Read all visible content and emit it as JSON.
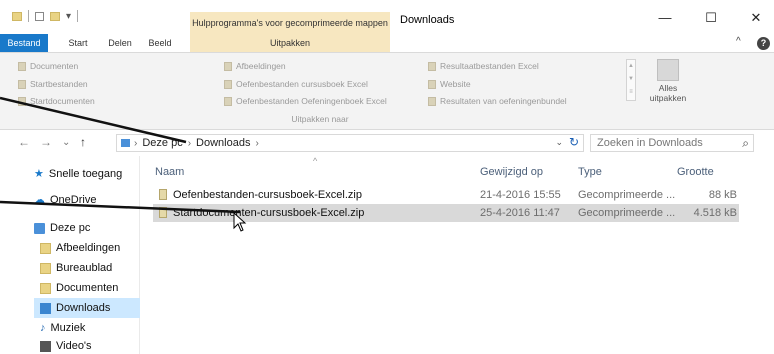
{
  "window": {
    "contextual_group_title": "Hulpprogramma's voor gecomprimeerde mappen",
    "title": "Downloads",
    "minimize": "—",
    "maximize": "☐",
    "close": "✕"
  },
  "ribbon_tabs": {
    "file": "Bestand",
    "home": "Start",
    "share": "Delen",
    "view": "Beeld",
    "extract": "Uitpakken",
    "collapse": "^",
    "help": "?"
  },
  "ribbon": {
    "destinations": [
      "Documenten",
      "Startbestanden",
      "Startdocumenten",
      "Afbeeldingen",
      "Oefenbestanden cursusboek Excel",
      "Oefenbestanden Oefeningenboek Excel",
      "Resultaatbestanden Excel",
      "Website",
      "Resultaten van oefeningenbundel"
    ],
    "group_label": "Uitpakken naar",
    "extract_all": "Alles uitpakken"
  },
  "address": {
    "back": "←",
    "forward": "→",
    "recent": "⌄",
    "up": "↑",
    "path": [
      "Deze pc",
      "Downloads"
    ],
    "dropdown": "⌄",
    "refresh": "↻",
    "search_placeholder": "Zoeken in Downloads",
    "search_icon": "⌕"
  },
  "nav_pane": {
    "items": [
      {
        "label": "Snelle toegang",
        "icon": "star-icon"
      },
      {
        "label": "OneDrive",
        "icon": "cloud-icon"
      },
      {
        "label": "Deze pc",
        "icon": "pc-icon"
      },
      {
        "label": "Afbeeldingen",
        "icon": "pictures-folder-icon"
      },
      {
        "label": "Bureaublad",
        "icon": "desktop-folder-icon"
      },
      {
        "label": "Documenten",
        "icon": "documents-folder-icon"
      },
      {
        "label": "Downloads",
        "icon": "downloads-folder-icon"
      },
      {
        "label": "Muziek",
        "icon": "music-icon"
      },
      {
        "label": "Video's",
        "icon": "video-icon"
      }
    ],
    "selected": "Downloads"
  },
  "file_list": {
    "columns": [
      "Naam",
      "Gewijzigd op",
      "Type",
      "Grootte"
    ],
    "sort_indicator": "^",
    "rows": [
      {
        "name": "Oefenbestanden-cursusboek-Excel.zip",
        "modified": "21-4-2016 15:55",
        "type": "Gecomprimeerde ...",
        "size": "88 kB"
      },
      {
        "name": "Startdocumenten-cursusboek-Excel.zip",
        "modified": "25-4-2016 11:47",
        "type": "Gecomprimeerde ...",
        "size": "4.518 kB"
      }
    ],
    "selected_row": 1
  },
  "colors": {
    "file_tab": "#1979ca",
    "contextual": "#f7e7c0",
    "selection": "#cce8ff",
    "row_selected": "#d9d9d9"
  }
}
